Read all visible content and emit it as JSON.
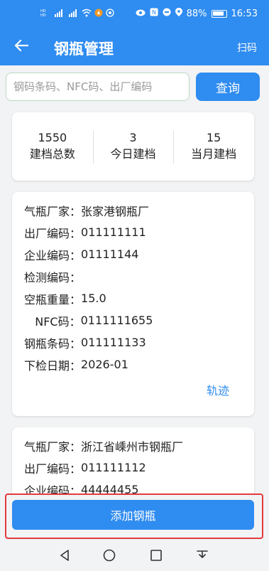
{
  "status_bar": {
    "time": "16:53",
    "battery": "88%",
    "icons": [
      "hd-icon",
      "signal-icon",
      "signal-icon",
      "wifi-icon",
      "notification-icon",
      "location-icon"
    ]
  },
  "app_bar": {
    "title": "钢瓶管理",
    "scan_label": "扫码",
    "back_icon": "arrow-left-icon"
  },
  "search": {
    "placeholder": "钢码条码、NFC码、出厂编码",
    "value": "",
    "button_label": "查询"
  },
  "stats": [
    {
      "value": "1550",
      "label": "建档总数"
    },
    {
      "value": "3",
      "label": "今日建档"
    },
    {
      "value": "15",
      "label": "当月建档"
    }
  ],
  "cylinders": [
    {
      "rows": [
        {
          "label": "气瓶厂家：",
          "value": "张家港钢瓶厂"
        },
        {
          "label": "出厂编码：",
          "value": "011111111"
        },
        {
          "label": "企业编码：",
          "value": "01111144"
        },
        {
          "label": "检测编码：",
          "value": ""
        },
        {
          "label": "空瓶重量：",
          "value": "15.0"
        },
        {
          "label": "   NFC码：",
          "value": "0111111655"
        },
        {
          "label": "钢瓶条码：",
          "value": "011111133"
        },
        {
          "label": "下检日期：",
          "value": "2026-01"
        }
      ],
      "track_label": "轨迹"
    },
    {
      "rows": [
        {
          "label": "气瓶厂家：",
          "value": "浙江省嵊州市钢瓶厂"
        },
        {
          "label": "出厂编码：",
          "value": "011111112"
        },
        {
          "label": "企业编码：",
          "value": "44444455"
        }
      ]
    }
  ],
  "add_button_label": "添加钢瓶",
  "colors": {
    "primary": "#2f8cf0",
    "highlight": "#e23b3b",
    "background": "#f2f3f5"
  }
}
